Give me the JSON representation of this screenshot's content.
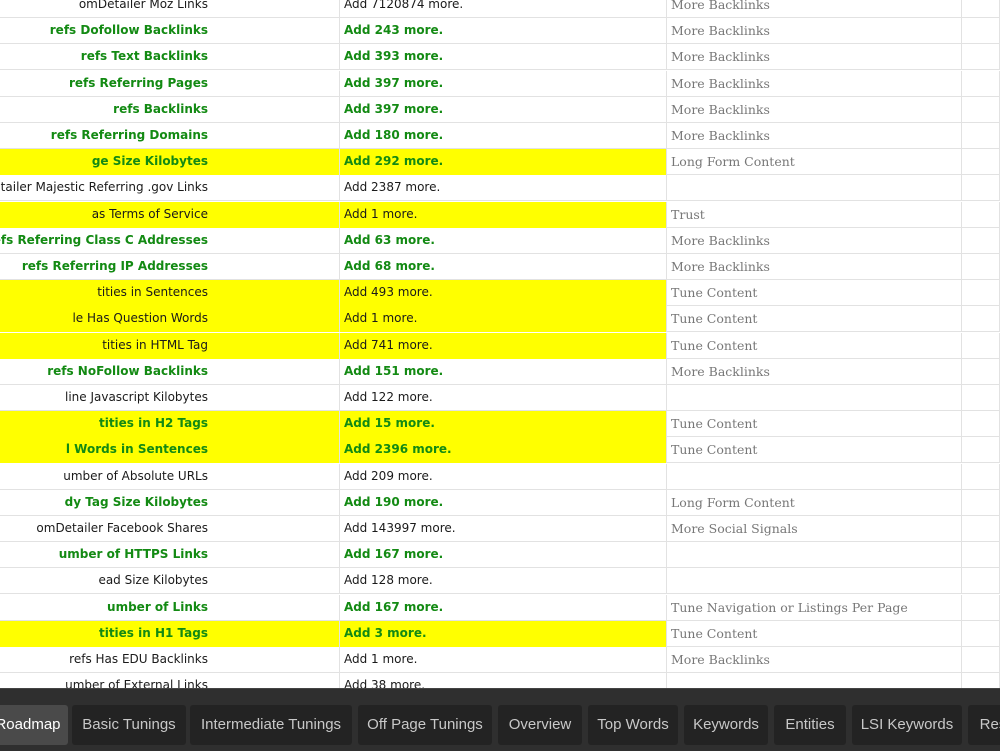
{
  "rows": [
    {
      "metric": "omDetailer Moz Links",
      "action": "Add 7120874 more.",
      "category": "More Backlinks",
      "green": false,
      "highlight": false
    },
    {
      "metric": "refs Dofollow Backlinks",
      "action": "Add 243 more.",
      "category": "More Backlinks",
      "green": true,
      "highlight": false
    },
    {
      "metric": "refs Text Backlinks",
      "action": "Add 393 more.",
      "category": "More Backlinks",
      "green": true,
      "highlight": false
    },
    {
      "metric": "refs Referring Pages",
      "action": "Add 397 more.",
      "category": "More Backlinks",
      "green": true,
      "highlight": false
    },
    {
      "metric": "refs Backlinks",
      "action": "Add 397 more.",
      "category": "More Backlinks",
      "green": true,
      "highlight": false
    },
    {
      "metric": "refs Referring Domains",
      "action": "Add 180 more.",
      "category": "More Backlinks",
      "green": true,
      "highlight": false
    },
    {
      "metric": "ge Size Kilobytes",
      "action": "Add 292 more.",
      "category": "Long Form Content",
      "green": true,
      "highlight": true
    },
    {
      "metric": "omDetailer Majestic Referring .gov Links",
      "action": "Add 2387 more.",
      "category": "",
      "green": false,
      "highlight": false
    },
    {
      "metric": "as Terms of Service",
      "action": "Add 1 more.",
      "category": "Trust",
      "green": false,
      "highlight": true
    },
    {
      "metric": "refs Referring Class C Addresses",
      "action": "Add 63 more.",
      "category": "More Backlinks",
      "green": true,
      "highlight": false
    },
    {
      "metric": "refs Referring IP Addresses",
      "action": "Add 68 more.",
      "category": "More Backlinks",
      "green": true,
      "highlight": false
    },
    {
      "metric": "tities in Sentences",
      "action": "Add 493 more.",
      "category": "Tune Content",
      "green": false,
      "highlight": true
    },
    {
      "metric": "le Has Question Words",
      "action": "Add 1 more.",
      "category": "Tune Content",
      "green": false,
      "highlight": true
    },
    {
      "metric": "tities in HTML Tag",
      "action": "Add 741 more.",
      "category": "Tune Content",
      "green": false,
      "highlight": true
    },
    {
      "metric": "refs NoFollow Backlinks",
      "action": "Add 151 more.",
      "category": "More Backlinks",
      "green": true,
      "highlight": false
    },
    {
      "metric": "line Javascript Kilobytes",
      "action": "Add 122 more.",
      "category": "",
      "green": false,
      "highlight": false
    },
    {
      "metric": "tities in H2 Tags",
      "action": "Add 15 more.",
      "category": "Tune Content",
      "green": true,
      "highlight": true
    },
    {
      "metric": "l Words in Sentences",
      "action": "Add 2396 more.",
      "category": "Tune Content",
      "green": true,
      "highlight": true
    },
    {
      "metric": "umber of Absolute URLs",
      "action": "Add 209 more.",
      "category": "",
      "green": false,
      "highlight": false
    },
    {
      "metric": "dy Tag Size Kilobytes",
      "action": "Add 190 more.",
      "category": "Long Form Content",
      "green": true,
      "highlight": false
    },
    {
      "metric": "omDetailer Facebook Shares",
      "action": "Add 143997 more.",
      "category": "More Social Signals",
      "green": false,
      "highlight": false
    },
    {
      "metric": "umber of HTTPS Links",
      "action": "Add 167 more.",
      "category": "",
      "green": true,
      "highlight": false
    },
    {
      "metric": "ead Size Kilobytes",
      "action": "Add 128 more.",
      "category": "",
      "green": false,
      "highlight": false
    },
    {
      "metric": "umber of Links",
      "action": "Add 167 more.",
      "category": "Tune Navigation or Listings Per Page",
      "green": true,
      "highlight": false
    },
    {
      "metric": "tities in H1 Tags",
      "action": "Add 3 more.",
      "category": "Tune Content",
      "green": true,
      "highlight": true
    },
    {
      "metric": "refs Has EDU Backlinks",
      "action": "Add 1 more.",
      "category": "More Backlinks",
      "green": false,
      "highlight": false
    },
    {
      "metric": "umber of External Links",
      "action": "Add 38 more.",
      "category": "",
      "green": false,
      "highlight": false
    }
  ],
  "tabs": [
    {
      "label": "Roadmap",
      "active": true
    },
    {
      "label": "Basic Tunings",
      "active": false
    },
    {
      "label": "Intermediate Tunings",
      "active": false
    },
    {
      "label": "Off Page Tunings",
      "active": false
    },
    {
      "label": "Overview",
      "active": false
    },
    {
      "label": "Top Words",
      "active": false
    },
    {
      "label": "Keywords",
      "active": false
    },
    {
      "label": "Entities",
      "active": false
    },
    {
      "label": "LSI Keywords",
      "active": false
    },
    {
      "label": "Res",
      "active": false
    }
  ]
}
